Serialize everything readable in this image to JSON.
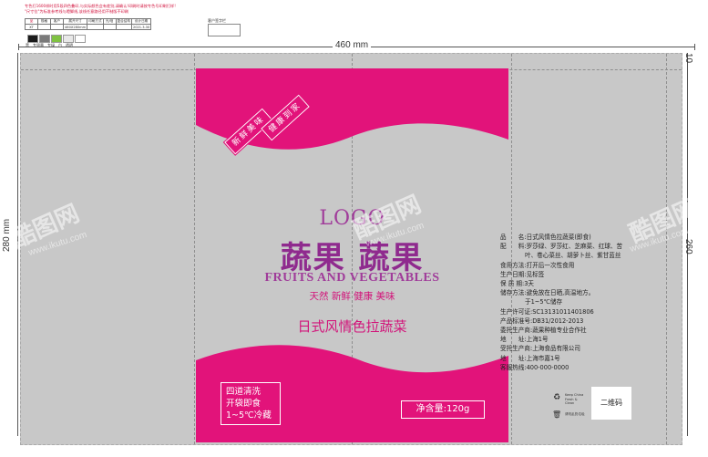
{
  "spec": {
    "notes": [
      "专色打1600样时用5段四色叠印,与实际颜色会有差别,请确认!印刷时请按专色号印刷打样!",
      "\"尺寸位\"为标准参考线与蹬脚线,该线任意路径用不制版不印刷"
    ],
    "table_row1": [
      "品",
      "规格",
      "客户",
      "展开尺寸",
      "印刷方式",
      "光/哑",
      "复合结构",
      "设计日期"
    ],
    "table_row2": [
      "XT",
      "",
      "",
      "460X280mm",
      "",
      "",
      "",
      "2021.3.30"
    ],
    "signature_label": "客户签字栏",
    "swatches": [
      "#1a1a1a",
      "#7a7a7a",
      "#7fc241",
      "#e8e8e8",
      "#ffffff"
    ],
    "swatch_labels": [
      "黑",
      "专银墨",
      "专绿",
      "白",
      "透明"
    ]
  },
  "dimensions": {
    "width": "460 mm",
    "height": "280 mm",
    "inner_height": "260",
    "top_margin": "10"
  },
  "front": {
    "tag1": "新鲜美味",
    "tag2": "健康到家",
    "logo": "LOGO",
    "brand": "蔬果 蔬果",
    "brand_en": "FRUITS AND VEGETABLES",
    "slogan": "天然 新鲜 健康 美味",
    "product": "日式风情色拉蔬菜",
    "features": [
      "四道清洗",
      "开袋即食",
      "1~5℃冷藏"
    ],
    "net_weight": "净含量:120g"
  },
  "back": {
    "info": [
      "品　　名:日式风情色拉蔬菜(即食)",
      "配　　料:罗莎绿、罗莎红、芝麻菜、红球、苦",
      "叶、卷心菜丝、胡萝卜丝、紫甘蓝丝",
      "食用方法:打开后一次性食用",
      "生产日期:见标签",
      "保 质 期:3天",
      "储存方法:避免放在日晒,高温地方。",
      "于1~5℃储存",
      "生产许可证:SC13131011401806",
      "产品标准号:DB31/2012-2013",
      "委托生产商:蔬果种植专业合作社",
      "地　　址:上海1号",
      "受托生产商:上海食品有限公司",
      "地　　址:上海市嘉1号",
      "客服热线:400-000-0000"
    ],
    "qr_label": "二维码",
    "recycle_text": "Keep China Fresh & Clean",
    "bin_text": "请勿乱扔垃圾"
  },
  "colors": {
    "magenta": "#e2137a",
    "bag_grey": "#c8c8c8",
    "purple": "#8f2a8e"
  },
  "watermarks": [
    "酷图网",
    "www.ikutu.com"
  ]
}
